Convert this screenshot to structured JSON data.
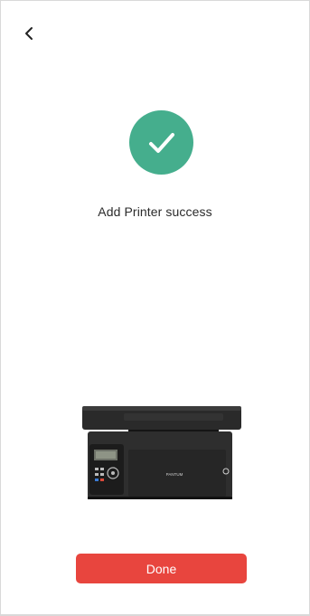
{
  "header": {
    "back_icon": "chevron-left-icon"
  },
  "status": {
    "icon": "checkmark-icon",
    "message": "Add Printer success",
    "accent_color": "#45ae8d"
  },
  "printer": {
    "brand_label": "PANTUM"
  },
  "actions": {
    "done_label": "Done",
    "done_color": "#e8453e"
  }
}
